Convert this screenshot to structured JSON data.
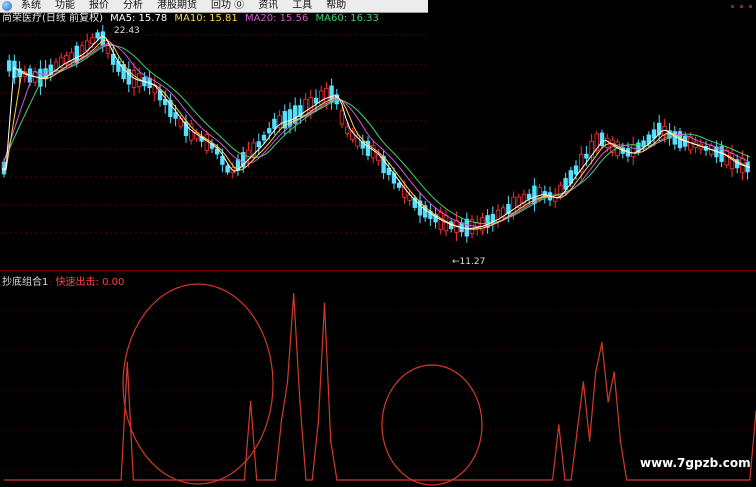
{
  "menu": {
    "items": [
      "系统",
      "功能",
      "报价",
      "分析",
      "港股期货",
      "回功 ⓪",
      "资讯",
      "工具",
      "帮助"
    ]
  },
  "main_chart": {
    "stock_label": "尚荣医疗(日线 前复权)",
    "ma5": "MA5: 15.78",
    "ma10": "MA10: 15.81",
    "ma20": "MA20: 15.56",
    "ma60": "MA60: 16.33",
    "high_label": "22.43",
    "low_label": "←11.27"
  },
  "indicator": {
    "name": "抄底组合1",
    "signal": "快速出击: 0.00"
  },
  "watermark": "www.7gpzb.com",
  "colors": {
    "up": "#ff3030",
    "down": "#55e0ff",
    "ma5": "#ffffff",
    "ma10": "#ffd24a",
    "ma20": "#d45ad4",
    "ma60": "#3fd46a",
    "indicator": "#d23a2a"
  },
  "chart_data": {
    "type": "line",
    "series": [
      {
        "name": "快速出击",
        "values": [
          0,
          0,
          0,
          0,
          0,
          0,
          0,
          0,
          0,
          0,
          0,
          0,
          0,
          0,
          0,
          0,
          0,
          0,
          0,
          0,
          0.6,
          0,
          0,
          0,
          0,
          0,
          0,
          0,
          0,
          0,
          0,
          0,
          0,
          0,
          0,
          0,
          0,
          0,
          0,
          0,
          0.4,
          0,
          0,
          0,
          0,
          0.3,
          0.5,
          0.95,
          0.4,
          0,
          0,
          0.3,
          0.9,
          0.2,
          0,
          0,
          0,
          0,
          0,
          0,
          0,
          0,
          0,
          0,
          0,
          0,
          0,
          0,
          0,
          0,
          0,
          0,
          0,
          0,
          0,
          0,
          0,
          0,
          0,
          0,
          0,
          0,
          0,
          0,
          0,
          0,
          0,
          0,
          0,
          0,
          0.28,
          0,
          0,
          0.25,
          0.5,
          0.2,
          0.55,
          0.7,
          0.4,
          0.55,
          0.2,
          0,
          0,
          0,
          0,
          0,
          0,
          0,
          0,
          0,
          0,
          0,
          0,
          0,
          0,
          0,
          0,
          0,
          0,
          0,
          0,
          0,
          0.35
        ]
      }
    ]
  }
}
